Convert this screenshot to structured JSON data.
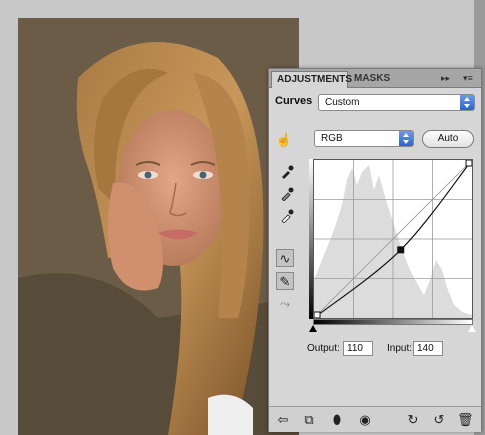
{
  "panel": {
    "tabs": [
      {
        "label": "ADJUSTMENTS",
        "active": true
      },
      {
        "label": "MASKS",
        "active": false
      }
    ],
    "title": "Curves",
    "preset": {
      "label": "Custom"
    },
    "channel": {
      "label": "RGB"
    },
    "auto_label": "Auto",
    "output_label": "Output:",
    "output_value": "110",
    "input_label": "Input:",
    "input_value": "140"
  },
  "curve": {
    "points": [
      {
        "input": 0,
        "output": 0
      },
      {
        "input": 140,
        "output": 110
      },
      {
        "input": 255,
        "output": 255
      }
    ]
  },
  "icons": {
    "tab_controls": [
      "collapse-icon",
      "panel-menu-icon"
    ],
    "tools": [
      "on-image-adjust-icon",
      "black-point-eyedropper-icon",
      "gray-point-eyedropper-icon",
      "white-point-eyedropper-icon",
      "curve-points-icon",
      "pencil-draw-icon",
      "smooth-icon"
    ],
    "bottom": [
      "back-arrow-icon",
      "expand-view-icon",
      "clip-to-layer-icon",
      "visibility-eye-icon",
      "view-previous-icon",
      "reset-icon",
      "trash-icon"
    ]
  }
}
